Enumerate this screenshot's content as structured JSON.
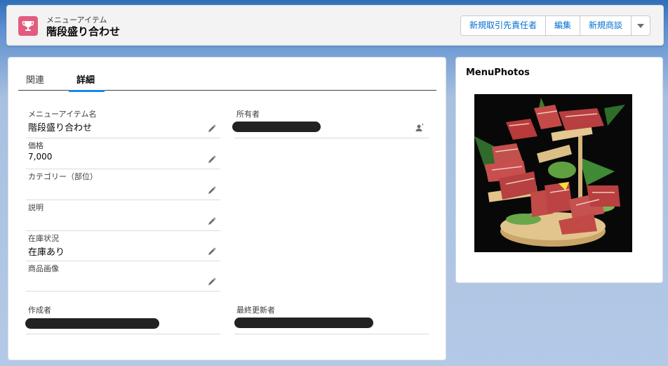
{
  "header": {
    "object_type": "メニューアイテム",
    "record_title": "階段盛り合わせ",
    "object_icon": "trophy-icon",
    "accent_color": "#e25c80",
    "buttons": [
      "新規取引先責任者",
      "編集",
      "新規商談"
    ]
  },
  "tabs": [
    {
      "label": "関連",
      "active": false
    },
    {
      "label": "詳細",
      "active": true
    }
  ],
  "fields": {
    "menu_item_name": {
      "label": "メニューアイテム名",
      "value": "階段盛り合わせ"
    },
    "owner": {
      "label": "所有者",
      "value": ""
    },
    "price": {
      "label": "価格",
      "value": "7,000"
    },
    "category": {
      "label": "カテゴリー（部位）",
      "value": ""
    },
    "description": {
      "label": "説明",
      "value": ""
    },
    "stock_status": {
      "label": "在庫状況",
      "value": "在庫あり"
    },
    "product_image": {
      "label": "商品画像",
      "value": ""
    },
    "created_by": {
      "label": "作成者",
      "value": ""
    },
    "last_modified_by": {
      "label": "最終更新者",
      "value": ""
    }
  },
  "photo_card": {
    "title": "MenuPhotos",
    "image": "wagyu-platter-photo"
  }
}
